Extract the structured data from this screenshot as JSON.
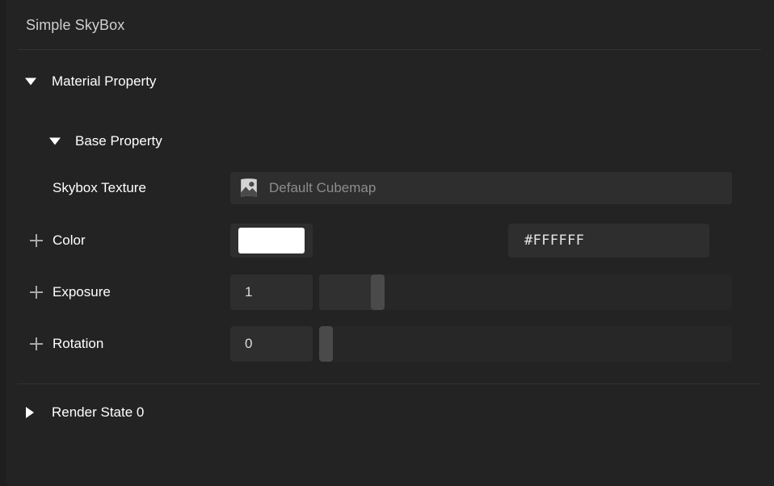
{
  "panel": {
    "title": "Simple SkyBox",
    "background_color": "#232323",
    "field_color": "#2e2e2e",
    "text_color": "#ffffff"
  },
  "sections": {
    "material_property": {
      "label": "Material Property",
      "expanded_icon": "triangle-down-icon",
      "expanded": true
    },
    "base_property": {
      "label": "Base Property",
      "expanded_icon": "triangle-down-icon",
      "expanded": true
    },
    "render_state": {
      "label": "Render State 0",
      "collapsed_icon": "triangle-right-icon",
      "expanded": false
    }
  },
  "properties": {
    "skybox_texture": {
      "label": "Skybox Texture",
      "value": "Default Cubemap",
      "icon": "image-asset-icon"
    },
    "color": {
      "label": "Color",
      "toggle_icon": "plus-icon",
      "swatch_color": "#FFFFFF",
      "hex": "#FFFFFF"
    },
    "exposure": {
      "label": "Exposure",
      "toggle_icon": "plus-icon",
      "value": "1",
      "slider_percent": 13
    },
    "rotation": {
      "label": "Rotation",
      "toggle_icon": "plus-icon",
      "value": "0",
      "slider_percent": 0
    }
  }
}
